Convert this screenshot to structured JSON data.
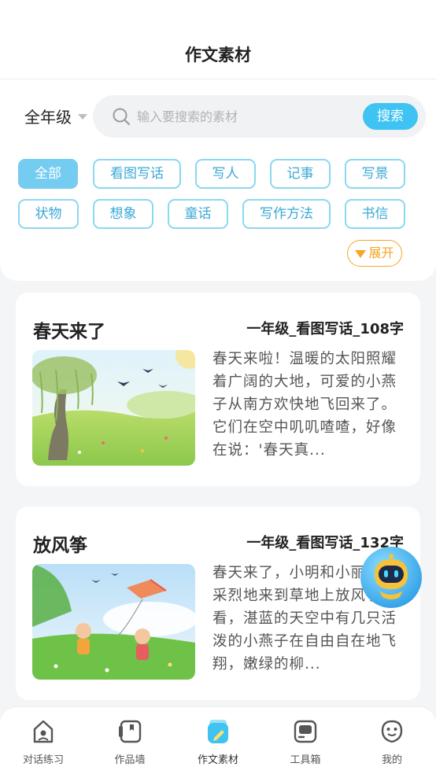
{
  "header": {
    "title": "作文素材"
  },
  "filter": {
    "grade": "全年级",
    "search_placeholder": "输入要搜索的素材",
    "search_button": "搜索",
    "chips": [
      "全部",
      "看图写话",
      "写人",
      "记事",
      "写景",
      "状物",
      "想象",
      "童话",
      "写作方法",
      "书信"
    ],
    "active_chip": "全部",
    "expand_label": "展开"
  },
  "cards": [
    {
      "title": "春天来了",
      "meta": "一年级_看图写话_108字",
      "excerpt": "春天来啦！温暖的太阳照耀着广阔的大地，可爱的小燕子从南方欢快地飞回来了。它们在空中叽叽喳喳，好像在说：'春天真..."
    },
    {
      "title": "放风筝",
      "meta": "一年级_看图写话_132字",
      "excerpt": "春天来了，小明和小丽兴高采烈地来到草地上放风筝。看，湛蓝的天空中有几只活泼的小燕子在自由自在地飞翔，嫩绿的柳..."
    }
  ],
  "tabbar": {
    "items": [
      {
        "label": "对话练习",
        "icon": "chat-practice-icon"
      },
      {
        "label": "作品墙",
        "icon": "works-wall-icon"
      },
      {
        "label": "作文素材",
        "icon": "essay-material-icon"
      },
      {
        "label": "工具箱",
        "icon": "toolbox-icon"
      },
      {
        "label": "我的",
        "icon": "profile-icon"
      }
    ],
    "active": "作文素材"
  },
  "colors": {
    "accent": "#3ec3f3",
    "chip_border": "#8ad8f2",
    "chip_active_bg": "#74cdf1",
    "expand": "#f5a623"
  }
}
